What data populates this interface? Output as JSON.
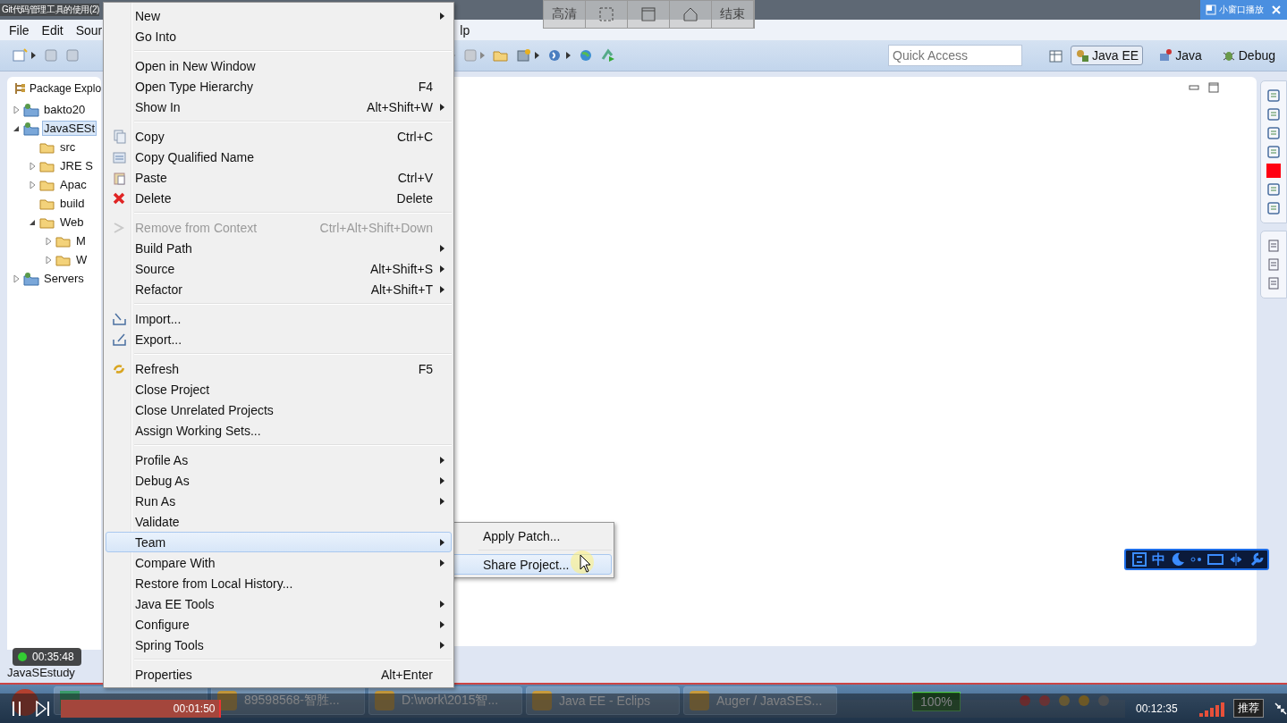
{
  "player_top": {
    "title": "Git代码管理工具的使用(2)",
    "controls": [
      {
        "kind": "text",
        "label": "高清"
      },
      {
        "kind": "crop"
      },
      {
        "kind": "window"
      },
      {
        "kind": "home"
      },
      {
        "kind": "text",
        "label": "结束"
      }
    ],
    "mini_window": "小窗口播放"
  },
  "menubar": [
    "File",
    "Edit",
    "Sour",
    "lp"
  ],
  "quick_access": {
    "placeholder": "Quick Access"
  },
  "perspectives": [
    {
      "label": "Java EE",
      "selected": true
    },
    {
      "label": "Java",
      "selected": false
    },
    {
      "label": "Debug",
      "selected": false
    }
  ],
  "explorer": {
    "title": "Package Explo",
    "tree": [
      {
        "label": "bakto20",
        "expanded": false,
        "selected": false
      },
      {
        "label": "JavaSESt",
        "expanded": true,
        "selected": true,
        "children": [
          {
            "label": "src",
            "selected": false
          },
          {
            "label": "JRE S",
            "expanded": false,
            "selected": false
          },
          {
            "label": "Apac",
            "expanded": false,
            "selected": false
          },
          {
            "label": "build",
            "selected": false
          },
          {
            "label": "Web",
            "expanded": true,
            "selected": false,
            "children": [
              {
                "label": "M",
                "expanded": false,
                "selected": false
              },
              {
                "label": "W",
                "expanded": false,
                "selected": false
              }
            ]
          }
        ]
      },
      {
        "label": "Servers",
        "expanded": false,
        "selected": false
      }
    ]
  },
  "status_bar": "JavaSEstudy",
  "context_menu": {
    "groups": [
      {
        "items": [
          {
            "label": "New",
            "submenu": true,
            "disabled": false,
            "selected": false
          },
          {
            "label": "Go Into",
            "submenu": false,
            "disabled": false,
            "selected": false
          }
        ]
      },
      {
        "items": [
          {
            "label": "Open in New Window",
            "submenu": false,
            "disabled": false,
            "selected": false
          },
          {
            "label": "Open Type Hierarchy",
            "shortcut": "F4",
            "submenu": false,
            "disabled": false,
            "selected": false
          },
          {
            "label": "Show In",
            "shortcut": "Alt+Shift+W",
            "submenu": true,
            "disabled": false,
            "selected": false
          }
        ]
      },
      {
        "items": [
          {
            "label": "Copy",
            "shortcut": "Ctrl+C",
            "submenu": false,
            "disabled": false,
            "selected": false
          },
          {
            "label": "Copy Qualified Name",
            "submenu": false,
            "disabled": false,
            "selected": false
          },
          {
            "label": "Paste",
            "shortcut": "Ctrl+V",
            "submenu": false,
            "disabled": false,
            "selected": false
          },
          {
            "label": "Delete",
            "shortcut": "Delete",
            "submenu": false,
            "disabled": false,
            "selected": false
          }
        ]
      },
      {
        "items": [
          {
            "label": "Remove from Context",
            "shortcut": "Ctrl+Alt+Shift+Down",
            "submenu": false,
            "disabled": true,
            "selected": false
          },
          {
            "label": "Build Path",
            "submenu": true,
            "disabled": false,
            "selected": false
          },
          {
            "label": "Source",
            "shortcut": "Alt+Shift+S",
            "submenu": true,
            "disabled": false,
            "selected": false
          },
          {
            "label": "Refactor",
            "shortcut": "Alt+Shift+T",
            "submenu": true,
            "disabled": false,
            "selected": false
          }
        ]
      },
      {
        "items": [
          {
            "label": "Import...",
            "submenu": false,
            "disabled": false,
            "selected": false
          },
          {
            "label": "Export...",
            "submenu": false,
            "disabled": false,
            "selected": false
          }
        ]
      },
      {
        "items": [
          {
            "label": "Refresh",
            "shortcut": "F5",
            "submenu": false,
            "disabled": false,
            "selected": false
          },
          {
            "label": "Close Project",
            "submenu": false,
            "disabled": false,
            "selected": false
          },
          {
            "label": "Close Unrelated Projects",
            "submenu": false,
            "disabled": false,
            "selected": false
          },
          {
            "label": "Assign Working Sets...",
            "submenu": false,
            "disabled": false,
            "selected": false
          }
        ]
      },
      {
        "items": [
          {
            "label": "Profile As",
            "submenu": true,
            "disabled": false,
            "selected": false
          },
          {
            "label": "Debug As",
            "submenu": true,
            "disabled": false,
            "selected": false
          },
          {
            "label": "Run As",
            "submenu": true,
            "disabled": false,
            "selected": false
          },
          {
            "label": "Validate",
            "submenu": false,
            "disabled": false,
            "selected": false
          },
          {
            "label": "Team",
            "submenu": true,
            "disabled": false,
            "selected": true
          },
          {
            "label": "Compare With",
            "submenu": true,
            "disabled": false,
            "selected": false
          },
          {
            "label": "Restore from Local History...",
            "submenu": false,
            "disabled": false,
            "selected": false
          },
          {
            "label": "Java EE Tools",
            "submenu": true,
            "disabled": false,
            "selected": false
          },
          {
            "label": "Configure",
            "submenu": true,
            "disabled": false,
            "selected": false
          },
          {
            "label": "Spring Tools",
            "submenu": true,
            "disabled": false,
            "selected": false
          }
        ]
      },
      {
        "items": [
          {
            "label": "Properties",
            "shortcut": "Alt+Enter",
            "submenu": false,
            "disabled": false,
            "selected": false
          }
        ]
      }
    ]
  },
  "submenu": {
    "items": [
      {
        "label": "Apply Patch...",
        "selected": false
      },
      {
        "label": "Share Project...",
        "selected": true
      }
    ]
  },
  "ime_bar": {
    "label": "中"
  },
  "taskbar": {
    "items": [
      {
        "label": "89598568-智胜..."
      },
      {
        "label": "D:\\work\\2015智..."
      },
      {
        "label": "Java EE - Eclips"
      },
      {
        "label": "Auger / JavaSES..."
      }
    ],
    "battery": "100%"
  },
  "player_controls": {
    "timer": "00:35:48",
    "elapsed": "00:01:50",
    "progress": {
      "level": 0.15
    },
    "total": "00:12:35",
    "recommend": "推荐"
  }
}
